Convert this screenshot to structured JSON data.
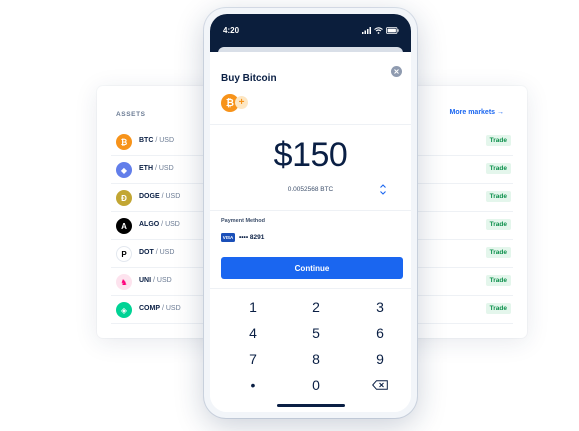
{
  "assets_panel": {
    "header": "ASSETS",
    "more_markets": "More markets →",
    "rows": [
      {
        "icon": "btc-icon",
        "base": "BTC",
        "quote": "USD",
        "trade": "Trade",
        "color": "#f7931a",
        "glyph": "₿"
      },
      {
        "icon": "eth-icon",
        "base": "ETH",
        "quote": "USD",
        "trade": "Trade",
        "color": "#627eea",
        "glyph": "◆"
      },
      {
        "icon": "doge-icon",
        "base": "DOGE",
        "quote": "USD",
        "trade": "Trade",
        "color": "#c2a633",
        "glyph": "Ð"
      },
      {
        "icon": "algo-icon",
        "base": "ALGO",
        "quote": "USD",
        "trade": "Trade",
        "color": "#000000",
        "glyph": "A"
      },
      {
        "icon": "dot-icon",
        "base": "DOT",
        "quote": "USD",
        "trade": "Trade",
        "color": "#ffffff",
        "glyph": "P"
      },
      {
        "icon": "uni-icon",
        "base": "UNI",
        "quote": "USD",
        "trade": "Trade",
        "color": "#fde3ee",
        "glyph": "♞"
      },
      {
        "icon": "comp-icon",
        "base": "COMP",
        "quote": "USD",
        "trade": "Trade",
        "color": "#00d395",
        "glyph": "◈"
      }
    ]
  },
  "phone": {
    "status_time": "4:20",
    "sheet_title": "Buy Bitcoin",
    "selected_coin_icon": "bitcoin-icon",
    "amount": "$150",
    "crypto_amount": "0.0052568 BTC",
    "payment_method_label": "Payment Method",
    "card_brand": "VISA",
    "card_number": "•••• 8291",
    "continue_label": "Continue",
    "keypad": [
      "1",
      "2",
      "3",
      "4",
      "5",
      "6",
      "7",
      "8",
      "9",
      "•",
      "0",
      "⌫"
    ]
  },
  "colors": {
    "primary": "#1a66f0",
    "navy": "#0b1e3c",
    "trade_green": "#0a8f4a",
    "bitcoin_orange": "#f7931a"
  }
}
